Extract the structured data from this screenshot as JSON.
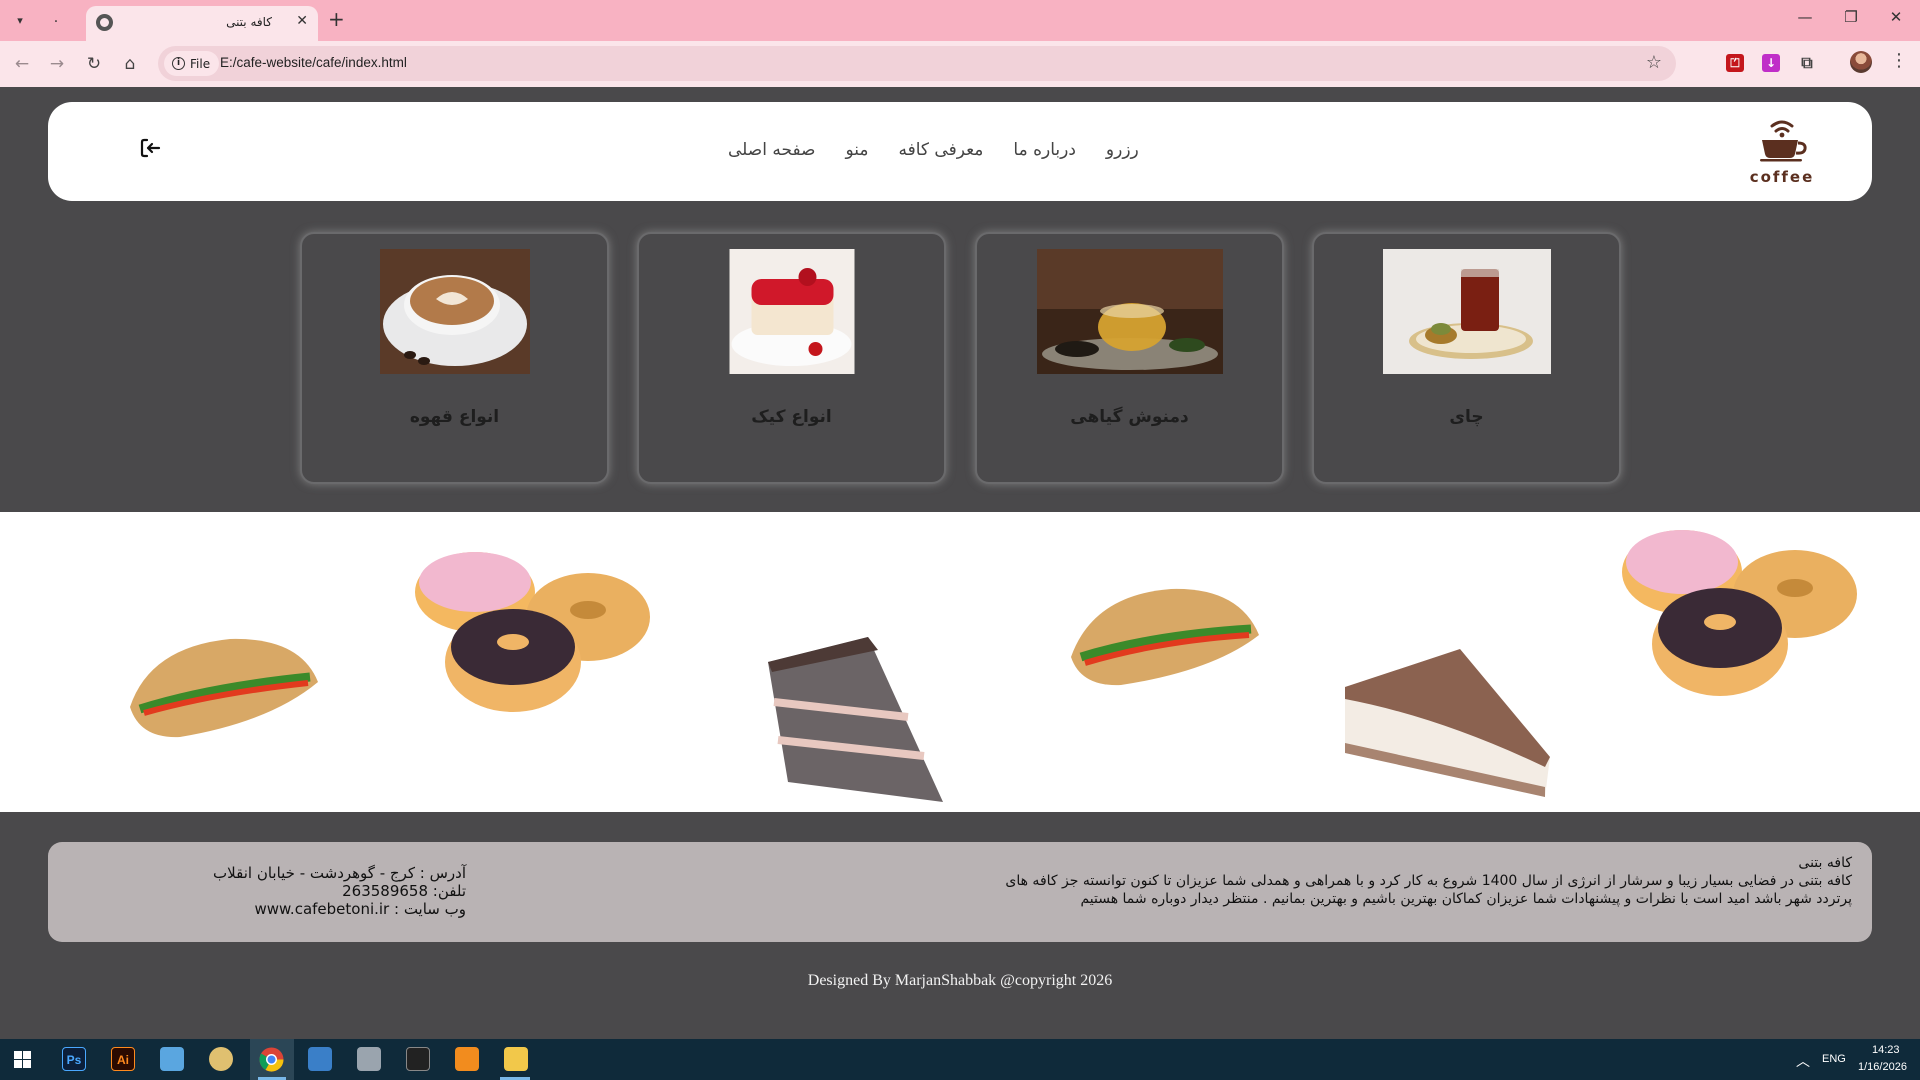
{
  "browser": {
    "tab_title": "کافه بتنی",
    "inactive_tab_glyph": ".",
    "url_scheme_label": "File",
    "url": "E:/cafe-website/cafe/index.html"
  },
  "header": {
    "logo_text": "coffee",
    "nav": [
      {
        "label": "صفحه اصلی"
      },
      {
        "label": "منو"
      },
      {
        "label": "معرفی کافه"
      },
      {
        "label": "درباره ما"
      },
      {
        "label": "رزرو"
      }
    ]
  },
  "categories": [
    {
      "label": "چای"
    },
    {
      "label": "دمنوش گیاهی"
    },
    {
      "label": "انواع کیک"
    },
    {
      "label": "انواع قهوه"
    }
  ],
  "footer": {
    "about_title": "کافه بتنی",
    "about_text": "کافه بتنی در فضایی بسیار زیبا و سرشار از انرژی از سال 1400 شروع به کار کرد و با همراهی و همدلی شما عزیزان تا کنون توانسته جز کافه های پرتردد شهر باشد امید است با نظرات و پیشنهادات شما عزیزان کماکان بهترین باشیم و بهترین بمانیم . منتظر دیدار دوباره شما هستیم",
    "address": "آدرس : کرج - گوهردشت - خیابان انقلاب",
    "phone": "تلفن: 263589658",
    "website": "وب سایت : www.cafebetoni.ir",
    "copyright": "Designed By MarjanShabbak @copyright 2026"
  },
  "taskbar": {
    "apps": [
      "Ps",
      "Ai"
    ],
    "language": "ENG",
    "time": "14:23",
    "date": "1/16/2026"
  },
  "colors": {
    "tabbar": "#f8b2c2",
    "toolbar": "#fbe5ea",
    "page_bg": "#4a494b",
    "footer_box": "#b9b3b4",
    "taskbar": "#0f2a3a",
    "coffee_brown": "#5b2f1f"
  },
  "icons": {
    "login": "login-arrow-icon",
    "logo": "coffee-cup-wifi-icon"
  }
}
